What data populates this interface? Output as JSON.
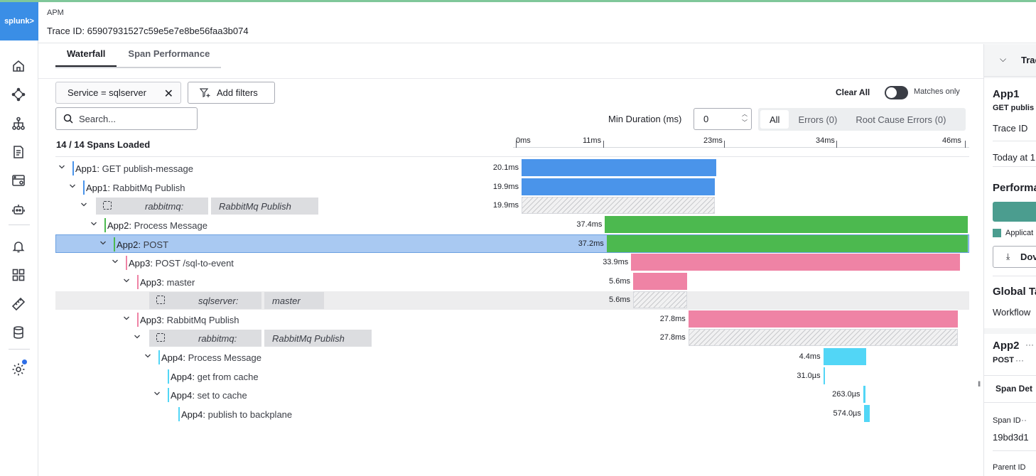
{
  "app": {
    "brand": "splunk>",
    "section": "APM",
    "trace_label": "Trace ID: 65907931527c59e5e7e8be56faa3b074"
  },
  "nav": {
    "icons": [
      "home-icon",
      "service-map-icon",
      "tree-icon",
      "logs-icon",
      "database-server-icon",
      "robot-icon",
      "bell-icon",
      "dashboards-icon",
      "ruler-icon",
      "cylinder-icon",
      "settings-icon"
    ]
  },
  "tabs": [
    {
      "label": "Waterfall",
      "active": true
    },
    {
      "label": "Span Performance",
      "active": false
    }
  ],
  "filters": {
    "chip": "Service = sqlserver",
    "add_label": "Add filters",
    "clear_all": "Clear All",
    "matches_only": "Matches only",
    "matches_only_on": true
  },
  "search": {
    "placeholder": "Search..."
  },
  "min_duration": {
    "label": "Min Duration (ms)",
    "value": "0"
  },
  "segments": [
    {
      "label": "All",
      "active": true
    },
    {
      "label": "Errors (0)",
      "active": false
    },
    {
      "label": "Root Cause Errors (0)",
      "active": false
    }
  ],
  "spans_loaded": "14 / 14 Spans Loaded",
  "axis": {
    "ticks": [
      "0ms",
      "11ms",
      "23ms",
      "34ms",
      "46ms"
    ],
    "max_ms": 46
  },
  "colors": {
    "app1": "#4a94ea",
    "app2": "#4cb94f",
    "app3": "#ef83a5",
    "app4": "#52d6f6",
    "selected": "#a9c9f2"
  },
  "spans": [
    {
      "service": "App1",
      "op": "GET publish-message",
      "duration": "20.1ms",
      "start_ms": 0,
      "dur_ms": 20.1,
      "color": "app1",
      "depth": 0
    },
    {
      "service": "App1",
      "op": "RabbitMq Publish",
      "duration": "19.9ms",
      "start_ms": 0,
      "dur_ms": 19.9,
      "color": "app1",
      "depth": 1
    },
    {
      "inferred": true,
      "service": "rabbitmq:",
      "op": "RabbitMq Publish",
      "duration": "19.9ms",
      "start_ms": 0,
      "dur_ms": 19.9,
      "depth": 2
    },
    {
      "service": "App2",
      "op": "Process Message",
      "duration": "37.4ms",
      "start_ms": 8.6,
      "dur_ms": 37.4,
      "color": "app2",
      "depth": 3
    },
    {
      "service": "App2",
      "op": "POST",
      "duration": "37.2ms",
      "start_ms": 8.7,
      "dur_ms": 37.2,
      "color": "app2",
      "depth": 4,
      "selected": true
    },
    {
      "service": "App3",
      "op": "POST /sql-to-event",
      "duration": "33.9ms",
      "start_ms": 11.3,
      "dur_ms": 33.9,
      "color": "app3",
      "depth": 5
    },
    {
      "service": "App3",
      "op": "master",
      "duration": "5.6ms",
      "start_ms": 11.5,
      "dur_ms": 5.6,
      "color": "app3",
      "depth": 6
    },
    {
      "inferred": true,
      "service": "sqlserver:",
      "op": "master",
      "duration": "5.6ms",
      "start_ms": 11.5,
      "dur_ms": 5.6,
      "depth": 7
    },
    {
      "service": "App3",
      "op": "RabbitMq Publish",
      "duration": "27.8ms",
      "start_ms": 17.2,
      "dur_ms": 27.8,
      "color": "app3",
      "depth": 6
    },
    {
      "inferred": true,
      "service": "rabbitmq:",
      "op": "RabbitMq Publish",
      "duration": "27.8ms",
      "start_ms": 17.2,
      "dur_ms": 27.8,
      "depth": 7
    },
    {
      "service": "App4",
      "op": "Process Message",
      "duration": "4.4ms",
      "start_ms": 31.1,
      "dur_ms": 4.4,
      "color": "app4",
      "depth": 8
    },
    {
      "service": "App4",
      "op": "get from cache",
      "duration": "31.0µs",
      "start_ms": 31.1,
      "dur_ms": 0.031,
      "color": "app4",
      "depth": 9
    },
    {
      "service": "App4",
      "op": "set to cache",
      "duration": "263.0µs",
      "start_ms": 35.2,
      "dur_ms": 0.263,
      "color": "app4",
      "depth": 9
    },
    {
      "service": "App4",
      "op": "publish to backplane",
      "duration": "574.0µs",
      "start_ms": 35.3,
      "dur_ms": 0.574,
      "color": "app4",
      "depth": 10
    }
  ],
  "right_panel": {
    "header": "Trac",
    "card1": {
      "service": "App1",
      "op": "GET publis",
      "trace_id": "Trace ID",
      "time": "Today at 1"
    },
    "performance": "Performa",
    "legend": "Applicat",
    "download": "Dov",
    "global_tags": "Global Ta",
    "workflow": "Workflow",
    "card2": {
      "service": "App2",
      "op": "POST"
    },
    "span_details": "Span Det",
    "span_id_label": "Span ID",
    "span_id_value": "19bd3d1",
    "parent_id_label": "Parent ID"
  }
}
